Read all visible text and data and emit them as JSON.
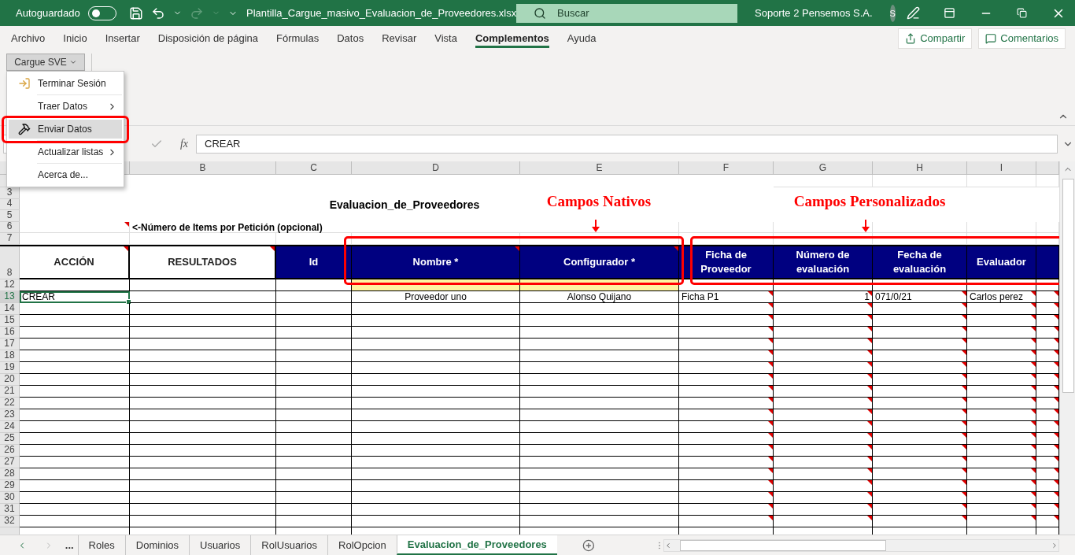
{
  "title_bar": {
    "autosave_label": "Autoguardado",
    "autosave_on": false,
    "file_name": "Plantilla_Cargue_masivo_Evaluacion_de_Proveedores.xlsx",
    "search_placeholder": "Buscar",
    "user_name": "Soporte 2 Pensemos S.A.",
    "user_initial": "S"
  },
  "ribbon_tabs": [
    {
      "label": "Archivo",
      "selected": false
    },
    {
      "label": "Inicio",
      "selected": false
    },
    {
      "label": "Insertar",
      "selected": false
    },
    {
      "label": "Disposición de página",
      "selected": false
    },
    {
      "label": "Fórmulas",
      "selected": false
    },
    {
      "label": "Datos",
      "selected": false
    },
    {
      "label": "Revisar",
      "selected": false
    },
    {
      "label": "Vista",
      "selected": false
    },
    {
      "label": "Complementos",
      "selected": true
    },
    {
      "label": "Ayuda",
      "selected": false
    }
  ],
  "ribbon_actions": [
    {
      "label": "Compartir",
      "kind": "share"
    },
    {
      "label": "Comentarios",
      "kind": "comments"
    }
  ],
  "addin_button": "Cargue SVE",
  "menu": {
    "items": [
      {
        "label": "Terminar Sesión",
        "submenu": false,
        "selected": false
      },
      {
        "label": "Traer Datos",
        "submenu": true,
        "selected": false
      },
      {
        "label": "Enviar Datos",
        "submenu": false,
        "selected": true
      },
      {
        "label": "Actualizar listas",
        "submenu": true,
        "selected": false
      },
      {
        "label": "Acerca de...",
        "submenu": false,
        "selected": false
      }
    ]
  },
  "formula_bar": {
    "fx": "fx",
    "value": "CREAR"
  },
  "sheet": {
    "column_headers": [
      "B",
      "C",
      "D",
      "E",
      "F",
      "G",
      "H",
      "I"
    ],
    "header_cells": [
      {
        "label": "ACCIÓN",
        "kind": "plain",
        "comment": true,
        "required": false,
        "data_comments": false
      },
      {
        "label": "RESULTADOS",
        "kind": "plain",
        "comment": true,
        "required": false,
        "data_comments": false
      },
      {
        "label": "Id",
        "kind": "field",
        "comment": false,
        "required": false,
        "data_comments": false
      },
      {
        "label": "Nombre *",
        "kind": "field",
        "comment": true,
        "required": true,
        "data_comments": false
      },
      {
        "label": "Configurador *",
        "kind": "field",
        "comment": true,
        "required": true,
        "data_comments": false
      },
      {
        "label": "Ficha de Proveedor",
        "kind": "field",
        "comment": false,
        "required": false,
        "data_comments": true
      },
      {
        "label": "Número de evaluación",
        "kind": "field",
        "comment": false,
        "required": false,
        "data_comments": true
      },
      {
        "label": "Fecha de evaluación",
        "kind": "field",
        "comment": false,
        "required": false,
        "data_comments": true
      },
      {
        "label": "Evaluador",
        "kind": "field",
        "comment": false,
        "required": false,
        "data_comments": true
      },
      {
        "kind": "field",
        "comment": false,
        "required": false,
        "data_comments": true
      }
    ],
    "rows": [
      {
        "number": "3",
        "kind": "banner"
      },
      {
        "number": "4",
        "kind": "title",
        "text": "Evaluacion_de_Proveedores"
      },
      {
        "number": "5",
        "kind": "banner"
      },
      {
        "number": "6",
        "kind": "note",
        "text": "<-Número de Items por Petición (opcional)",
        "comment": true
      },
      {
        "number": "7",
        "kind": "plain"
      },
      {
        "number": "8",
        "kind": "header"
      },
      {
        "number": "12",
        "kind": "required"
      },
      {
        "number": "13",
        "kind": "data",
        "cells": {
          "A": {
            "text": "CREAR",
            "selected": true
          },
          "D": {
            "text": "Proveedor uno",
            "selected": false
          },
          "E": {
            "text": "Alonso Quijano",
            "selected": false
          },
          "F": {
            "text": "Ficha P1",
            "selected": false
          },
          "G": {
            "text": "1",
            "selected": false
          },
          "H": {
            "text": "071/0/21",
            "selected": false
          },
          "I": {
            "text": "Carlos perez",
            "selected": false
          }
        }
      },
      {
        "number": "14",
        "kind": "empty"
      },
      {
        "number": "15",
        "kind": "empty"
      },
      {
        "number": "16",
        "kind": "empty"
      },
      {
        "number": "17",
        "kind": "empty"
      },
      {
        "number": "18",
        "kind": "empty"
      },
      {
        "number": "19",
        "kind": "empty"
      },
      {
        "number": "20",
        "kind": "empty"
      },
      {
        "number": "21",
        "kind": "empty"
      },
      {
        "number": "22",
        "kind": "empty"
      },
      {
        "number": "23",
        "kind": "empty"
      },
      {
        "number": "24",
        "kind": "empty"
      },
      {
        "number": "25",
        "kind": "empty"
      },
      {
        "number": "26",
        "kind": "empty"
      },
      {
        "number": "27",
        "kind": "empty"
      },
      {
        "number": "28",
        "kind": "empty"
      },
      {
        "number": "29",
        "kind": "empty"
      },
      {
        "number": "30",
        "kind": "empty"
      },
      {
        "number": "31",
        "kind": "empty"
      },
      {
        "number": "32",
        "kind": "empty"
      }
    ],
    "annotations": [
      {
        "label": "Campos Nativos"
      },
      {
        "label": "Campos Personalizados"
      }
    ]
  },
  "sheet_nav_more": "...",
  "sheet_tabs": [
    {
      "label": "Roles",
      "selected": false
    },
    {
      "label": "Dominios",
      "selected": false
    },
    {
      "label": "Usuarios",
      "selected": false
    },
    {
      "label": "RolUsuarios",
      "selected": false
    },
    {
      "label": "RolOpcion",
      "selected": false
    },
    {
      "label": "Evaluacion_de_Proveedores",
      "selected": true
    }
  ]
}
